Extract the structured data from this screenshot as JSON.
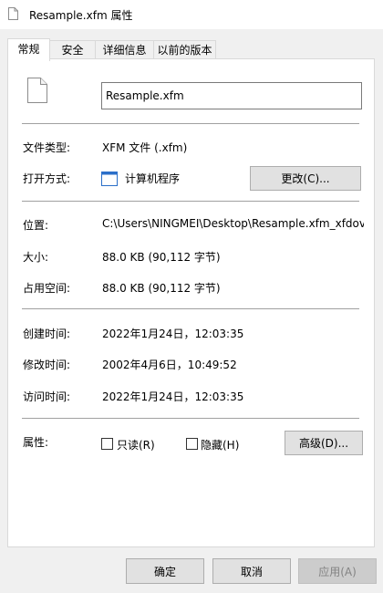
{
  "window": {
    "title": "Resample.xfm 属性"
  },
  "tabs": [
    {
      "label": "常规",
      "active": true
    },
    {
      "label": "安全",
      "active": false
    },
    {
      "label": "详细信息",
      "active": false
    },
    {
      "label": "以前的版本",
      "active": false
    }
  ],
  "general": {
    "file_name": "Resample.xfm",
    "file_type_label": "文件类型:",
    "file_type_value": "XFM 文件 (.xfm)",
    "open_with_label": "打开方式:",
    "open_with_value": "计算机程序",
    "change_button": "更改(C)...",
    "location_label": "位置:",
    "location_value": "C:\\Users\\NINGMEI\\Desktop\\Resample.xfm_xfdov",
    "size_label": "大小:",
    "size_value": "88.0 KB (90,112 字节)",
    "size_on_disk_label": "占用空间:",
    "size_on_disk_value": "88.0 KB (90,112 字节)",
    "created_label": "创建时间:",
    "created_value": "2022年1月24日，12:03:35",
    "modified_label": "修改时间:",
    "modified_value": "2002年4月6日，10:49:52",
    "accessed_label": "访问时间:",
    "accessed_value": "2022年1月24日，12:03:35",
    "attributes_label": "属性:",
    "readonly_label": "只读(R)",
    "readonly_checked": false,
    "hidden_label": "隐藏(H)",
    "hidden_checked": false,
    "advanced_button": "高级(D)..."
  },
  "footer": {
    "ok_button": "确定",
    "cancel_button": "取消",
    "apply_button": "应用(A)"
  },
  "icons": {
    "title": "file-icon",
    "file": "file-icon",
    "open_with": "application-window-icon"
  }
}
